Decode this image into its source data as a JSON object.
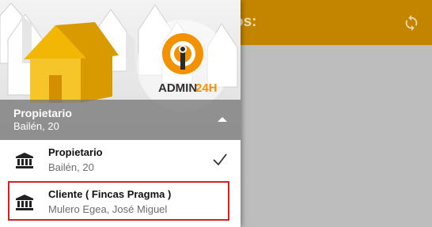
{
  "app": {
    "title_fragment": "os:",
    "sync_icon": "sync-icon"
  },
  "drawer": {
    "logo_text": "ADMIN24H",
    "logo_prefix": "ADMIN",
    "logo_suffix": "24H",
    "current_account": {
      "name": "Propietario",
      "address": "Bailén, 20"
    },
    "accounts": [
      {
        "title": "Propietario",
        "subtitle": "Bailén, 20",
        "icon": "bank-icon",
        "selected": true
      },
      {
        "title": "Cliente ( Fincas Pragma )",
        "subtitle": "Mulero Egea, José Miguel",
        "icon": "bank-icon",
        "selected": false
      }
    ]
  },
  "colors": {
    "toolbar": "#c38500",
    "logo_orange": "#f39200",
    "house_yellow": "#f2b705",
    "highlight": "#d32020"
  }
}
